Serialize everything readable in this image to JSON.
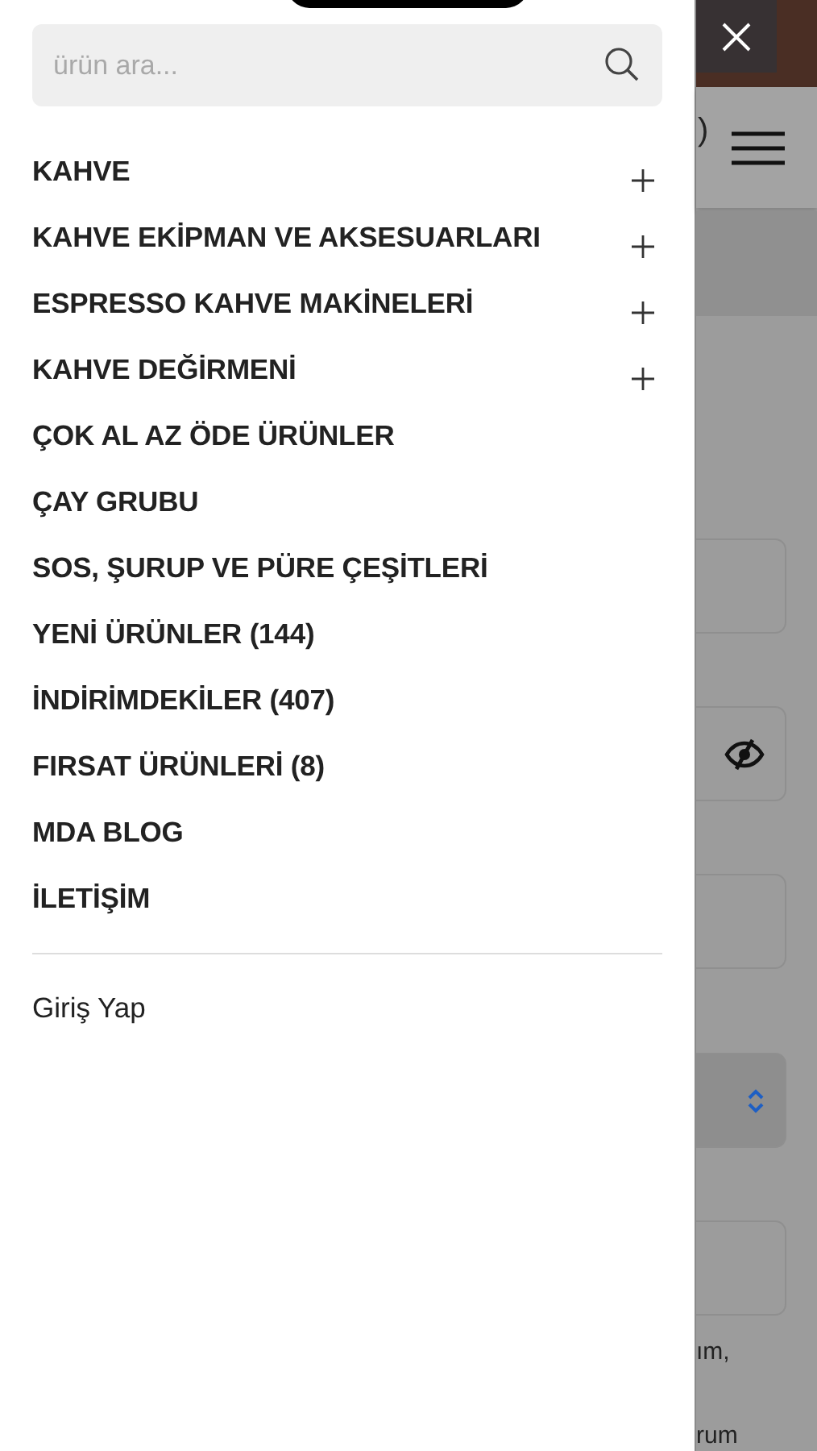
{
  "drawer": {
    "search": {
      "placeholder": "ürün ara..."
    },
    "menu": [
      {
        "label": "KAHVE",
        "expandable": true
      },
      {
        "label": "KAHVE EKİPMAN VE AKSESUARLARI",
        "expandable": true
      },
      {
        "label": "ESPRESSO KAHVE MAKİNELERİ",
        "expandable": true
      },
      {
        "label": "KAHVE DEĞİRMENİ",
        "expandable": true
      },
      {
        "label": "ÇOK AL AZ ÖDE ÜRÜNLER",
        "expandable": false
      },
      {
        "label": "ÇAY GRUBU",
        "expandable": false
      },
      {
        "label": "SOS, ŞURUP VE PÜRE ÇEŞİTLERİ",
        "expandable": false
      },
      {
        "label": "YENİ ÜRÜNLER (144)",
        "expandable": false
      },
      {
        "label": "İNDİRİMDEKİLER (407)",
        "expandable": false
      },
      {
        "label": "FIRSAT ÜRÜNLERİ (8)",
        "expandable": false
      },
      {
        "label": "MDA BLOG",
        "expandable": false
      },
      {
        "label": "İLETİŞİM",
        "expandable": false
      }
    ],
    "login": "Giriş Yap"
  },
  "background_page": {
    "fields": [
      {
        "kind": "text"
      },
      {
        "kind": "password"
      },
      {
        "kind": "text"
      },
      {
        "kind": "select"
      },
      {
        "kind": "text"
      }
    ],
    "header_glyph": ")",
    "texts": [
      "ım,",
      "rum"
    ]
  }
}
